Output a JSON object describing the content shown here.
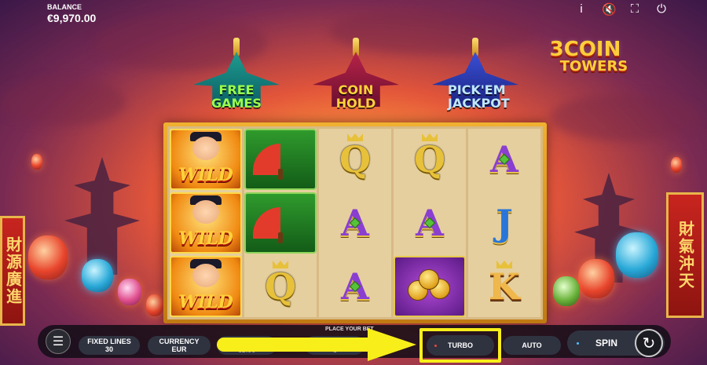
{
  "balance": {
    "label": "BALANCE",
    "value": "€9,970.00"
  },
  "top_icons": {
    "info": "i",
    "sound": "🔇",
    "fullscreen": "⛶",
    "power": "⏻"
  },
  "logo": {
    "line1": "3COIN",
    "line2": "TOWERS"
  },
  "towers": [
    {
      "line1": "FREE",
      "line2": "GAMES"
    },
    {
      "line1": "COIN",
      "line2": "HOLD"
    },
    {
      "line1": "PICK'EM",
      "line2": "JACKPOT"
    }
  ],
  "reels": {
    "wild_label": "WILD",
    "letters": {
      "q": "Q",
      "a": "A",
      "j": "J",
      "k": "K"
    }
  },
  "banners": {
    "left": "財源廣進",
    "right": "財氣沖天"
  },
  "controls": {
    "place_bet": "PLACE YOUR BET",
    "fixed_lines_label": "FIXED LINES",
    "fixed_lines_value": "30",
    "currency_label": "CURRENCY",
    "currency_value": "EUR",
    "bet1": "€3.00",
    "bet2": "€",
    "turbo": "TURBO",
    "auto": "AUTO",
    "spin": "SPIN",
    "menu_icon": "☰",
    "spin_icon": "↻"
  },
  "colors": {
    "highlight": "#f7ee1a",
    "bar_bg": "#14101a",
    "pill": "#2f3340"
  }
}
